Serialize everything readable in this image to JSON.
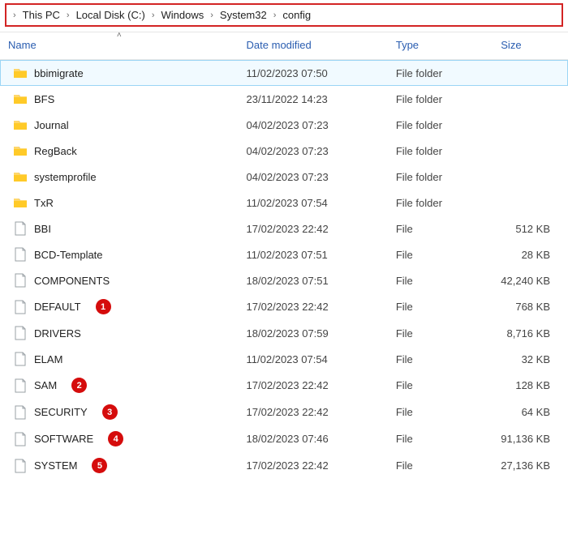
{
  "breadcrumb": {
    "items": [
      "This PC",
      "Local Disk (C:)",
      "Windows",
      "System32",
      "config"
    ]
  },
  "columns": {
    "name": "Name",
    "date": "Date modified",
    "type": "Type",
    "size": "Size",
    "sort_indicator": "˄"
  },
  "icons": {
    "folder": "folder-icon",
    "file": "file-icon",
    "chevron": "chevron-right-icon"
  },
  "rows": [
    {
      "name": "bbimigrate",
      "date": "11/02/2023 07:50",
      "type": "File folder",
      "size": "",
      "icon": "folder",
      "selected": true,
      "badge": ""
    },
    {
      "name": "BFS",
      "date": "23/11/2022 14:23",
      "type": "File folder",
      "size": "",
      "icon": "folder",
      "selected": false,
      "badge": ""
    },
    {
      "name": "Journal",
      "date": "04/02/2023 07:23",
      "type": "File folder",
      "size": "",
      "icon": "folder",
      "selected": false,
      "badge": ""
    },
    {
      "name": "RegBack",
      "date": "04/02/2023 07:23",
      "type": "File folder",
      "size": "",
      "icon": "folder",
      "selected": false,
      "badge": ""
    },
    {
      "name": "systemprofile",
      "date": "04/02/2023 07:23",
      "type": "File folder",
      "size": "",
      "icon": "folder",
      "selected": false,
      "badge": ""
    },
    {
      "name": "TxR",
      "date": "11/02/2023 07:54",
      "type": "File folder",
      "size": "",
      "icon": "folder",
      "selected": false,
      "badge": ""
    },
    {
      "name": "BBI",
      "date": "17/02/2023 22:42",
      "type": "File",
      "size": "512 KB",
      "icon": "file",
      "selected": false,
      "badge": ""
    },
    {
      "name": "BCD-Template",
      "date": "11/02/2023 07:51",
      "type": "File",
      "size": "28 KB",
      "icon": "file",
      "selected": false,
      "badge": ""
    },
    {
      "name": "COMPONENTS",
      "date": "18/02/2023 07:51",
      "type": "File",
      "size": "42,240 KB",
      "icon": "file",
      "selected": false,
      "badge": ""
    },
    {
      "name": "DEFAULT",
      "date": "17/02/2023 22:42",
      "type": "File",
      "size": "768 KB",
      "icon": "file",
      "selected": false,
      "badge": "1"
    },
    {
      "name": "DRIVERS",
      "date": "18/02/2023 07:59",
      "type": "File",
      "size": "8,716 KB",
      "icon": "file",
      "selected": false,
      "badge": ""
    },
    {
      "name": "ELAM",
      "date": "11/02/2023 07:54",
      "type": "File",
      "size": "32 KB",
      "icon": "file",
      "selected": false,
      "badge": ""
    },
    {
      "name": "SAM",
      "date": "17/02/2023 22:42",
      "type": "File",
      "size": "128 KB",
      "icon": "file",
      "selected": false,
      "badge": "2"
    },
    {
      "name": "SECURITY",
      "date": "17/02/2023 22:42",
      "type": "File",
      "size": "64 KB",
      "icon": "file",
      "selected": false,
      "badge": "3"
    },
    {
      "name": "SOFTWARE",
      "date": "18/02/2023 07:46",
      "type": "File",
      "size": "91,136 KB",
      "icon": "file",
      "selected": false,
      "badge": "4"
    },
    {
      "name": "SYSTEM",
      "date": "17/02/2023 22:42",
      "type": "File",
      "size": "27,136 KB",
      "icon": "file",
      "selected": false,
      "badge": "5"
    }
  ]
}
